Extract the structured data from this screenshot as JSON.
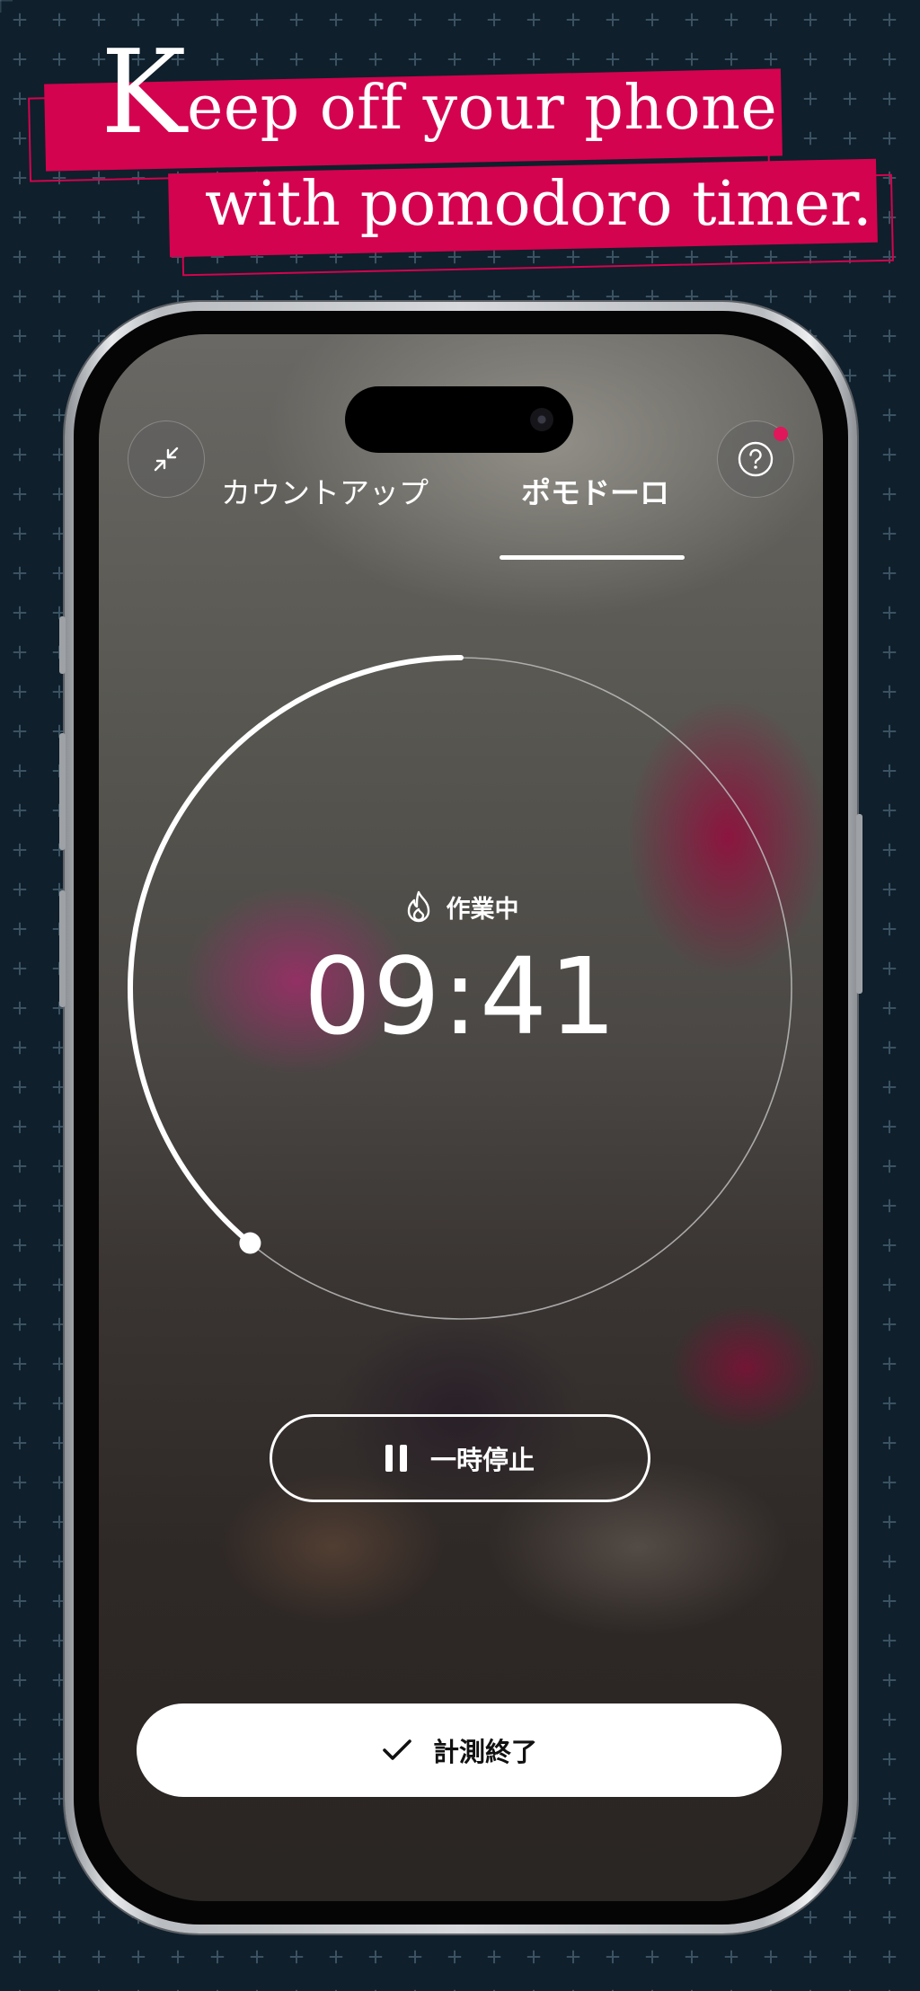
{
  "headline": {
    "line1_initial": "K",
    "line1_rest": "eep off your phone",
    "line2": "with pomodoro timer."
  },
  "tabs": [
    {
      "label": "カウントアップ",
      "selected": false
    },
    {
      "label": "ポモドーロ",
      "selected": true
    }
  ],
  "top_buttons": {
    "left_icon": "collapse-arrows-icon",
    "right_icon": "help-icon",
    "right_has_notification": true
  },
  "timer": {
    "status_icon": "flame-icon",
    "status_label": "作業中",
    "time": "09:41",
    "progress_fraction": 0.39
  },
  "pause_button": {
    "icon": "pause-icon",
    "label": "一時停止"
  },
  "end_button": {
    "icon": "check-icon",
    "label": "計測終了"
  },
  "colors": {
    "background": "#0f1f2b",
    "accent": "#d4034f",
    "ring_track": "#b5b5b5",
    "ring_progress": "#ffffff"
  }
}
